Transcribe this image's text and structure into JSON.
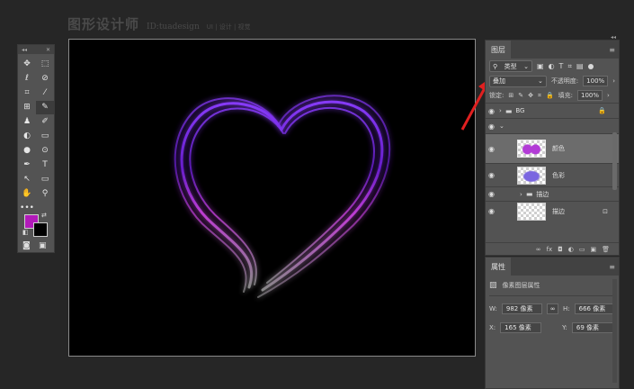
{
  "watermark": {
    "title": "图形设计师",
    "id": "ID:tuadesign",
    "tags": "UI | 设计 | 视觉"
  },
  "tools": {
    "header_left": "◂◂",
    "header_right": "✕",
    "icons": [
      "✥",
      "⬚",
      "ℓ",
      "⊘",
      "⌗",
      "⁄",
      "⊞",
      "✎",
      "♟",
      "✐",
      "◐",
      "▭",
      "●",
      "⊙",
      "✒",
      "T",
      "↖",
      "▭",
      "✋",
      "⚲",
      "•••"
    ],
    "foreground_color": "#b21ab9",
    "background_color": "#000000"
  },
  "canvas": {
    "background": "#000000"
  },
  "layers_panel": {
    "tab_label": "图层",
    "filter_label": "类型",
    "blend_mode": "叠加",
    "opacity_label": "不透明度:",
    "opacity_value": "100%",
    "lock_label": "锁定:",
    "fill_label": "填充:",
    "fill_value": "100%",
    "layers": [
      {
        "name": "BG",
        "type": "group"
      },
      {
        "name": "颜色",
        "type": "layer"
      },
      {
        "name": "色彩",
        "type": "layer"
      },
      {
        "name": "描边",
        "type": "group"
      },
      {
        "name": "描边",
        "type": "layer"
      }
    ],
    "footer_icons": [
      "∞",
      "fx",
      "◘",
      "◐",
      "▭",
      "▣",
      "🗑"
    ]
  },
  "properties_panel": {
    "tab_label": "属性",
    "section_label": "像素图层属性",
    "w_label": "W:",
    "w_value": "982 像素",
    "h_label": "H:",
    "h_value": "666 像素",
    "x_label": "X:",
    "x_value": "165 像素",
    "y_label": "Y:",
    "y_value": "69 像素",
    "link_icon": "∞"
  },
  "annotation": {
    "color": "#e02020"
  },
  "heart": {
    "colors": [
      "#9b30ff",
      "#6a1fd1",
      "#c43fd6",
      "#8a8a8a"
    ]
  }
}
